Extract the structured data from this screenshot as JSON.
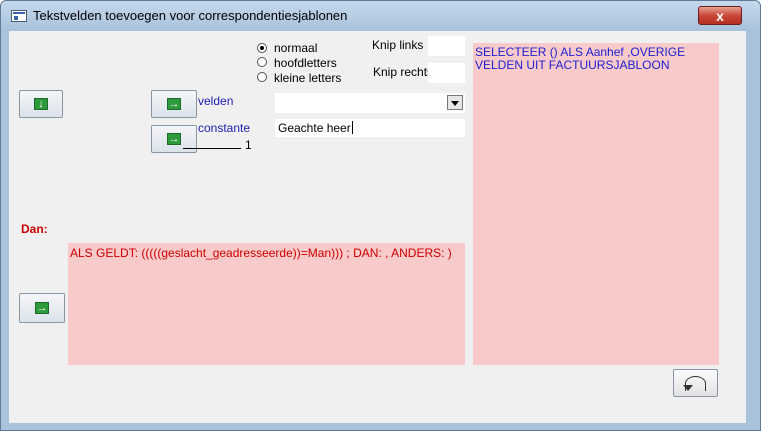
{
  "window": {
    "title": "Tekstvelden toevoegen voor correspondentiesjablonen",
    "close_label": "x"
  },
  "case_options": {
    "items": [
      {
        "label": "normaal",
        "selected": true
      },
      {
        "label": "hoofdletters",
        "selected": false
      },
      {
        "label": "kleine letters",
        "selected": false
      }
    ]
  },
  "trim": {
    "left_label": "Knip links",
    "left_value": "",
    "right_label": "Knip rechts",
    "right_value": ""
  },
  "velden": {
    "label": "velden",
    "value": ""
  },
  "constante": {
    "label": "constante",
    "value": "Geachte heer"
  },
  "counter_value": "1",
  "dan_label": "Dan:",
  "condition_text": "ALS GELDT: (((((geslacht_geadresseerde))=Man))) ; DAN:  , ANDERS: )",
  "output_text": "SELECTEER () ALS Aanhef ,OVERIGE VELDEN UIT FACTUURSJABLOON",
  "colors": {
    "pink_bg": "#f8caca",
    "label_blue": "#1d1dae",
    "red_text": "#cc0000",
    "output_text": "#2020d0"
  }
}
